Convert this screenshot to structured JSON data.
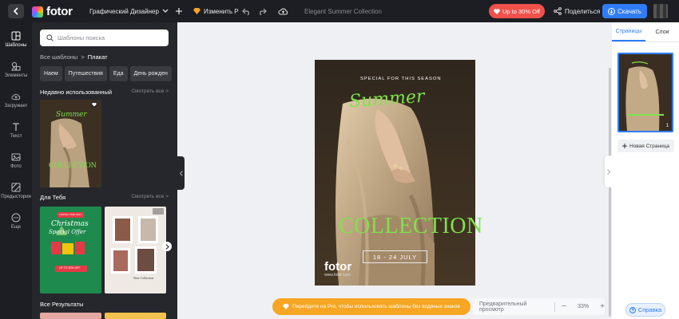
{
  "topbar": {
    "brand": "fotor",
    "mode_label": "Графический Дизайнер",
    "rename_label": "Изменить Р",
    "doc_title": "Elegant Summer Collection",
    "promo_label": "Up to 30% Off",
    "share_label": "Поделиться",
    "download_label": "Скачать"
  },
  "rail": {
    "items": [
      {
        "label": "Шаблоны",
        "icon": "templates-icon"
      },
      {
        "label": "Элементы",
        "icon": "elements-icon"
      },
      {
        "label": "Загружает",
        "icon": "upload-icon"
      },
      {
        "label": "Текст",
        "icon": "text-icon"
      },
      {
        "label": "Фото",
        "icon": "photo-icon"
      },
      {
        "label": "Предыстория",
        "icon": "background-icon"
      },
      {
        "label": "Еще",
        "icon": "more-icon"
      }
    ]
  },
  "panel": {
    "search_placeholder": "Шаблоны поиска",
    "breadcrumb": {
      "root": "Все шаблоны",
      "sep": ">",
      "current": "Плакат"
    },
    "chips": [
      "Наем",
      "Путешествия",
      "Еда",
      "День рожден"
    ],
    "recent": {
      "title": "Недавно использованный",
      "more": "Смотреть все >"
    },
    "for_you": {
      "title": "Для Тебя",
      "more": "Смотреть все >"
    },
    "all_results": {
      "title": "Все Результаты"
    },
    "recent_thumb": {
      "script": "Summer",
      "word": "COLLECTION"
    },
    "thumb_christmas": {
      "badge": "LIMITED TIME ONLY",
      "line1": "Christmas",
      "line2": "Special Offer",
      "button": "UP TO 30% OFF"
    },
    "thumb_collage": {
      "caption": "New Collection"
    }
  },
  "poster": {
    "kicker": "SPECIAL FOR THIS SEASON",
    "script": "Summer",
    "headline": "COLLECTION",
    "date": "18 - 24 JULY",
    "logo": "fotor",
    "url": "www.fotor.com"
  },
  "bottom": {
    "pro_banner": "Перейдите на Pro, чтобы использовать шаблоны без водяных знаков",
    "preview_label": "Предварительный просмотр",
    "zoom_minus": "−",
    "zoom_value": "33%",
    "zoom_plus": "+"
  },
  "right_panel": {
    "tab_pages": "Страницы",
    "tab_layers": "Слои",
    "page_number": "1",
    "new_page_label": "Новая Страница",
    "help_label": "Справка"
  },
  "colors": {
    "accent": "#2f7cf6",
    "promo": "#f0514b",
    "pro": "#f6a622",
    "poster_green": "#7ee24a"
  }
}
